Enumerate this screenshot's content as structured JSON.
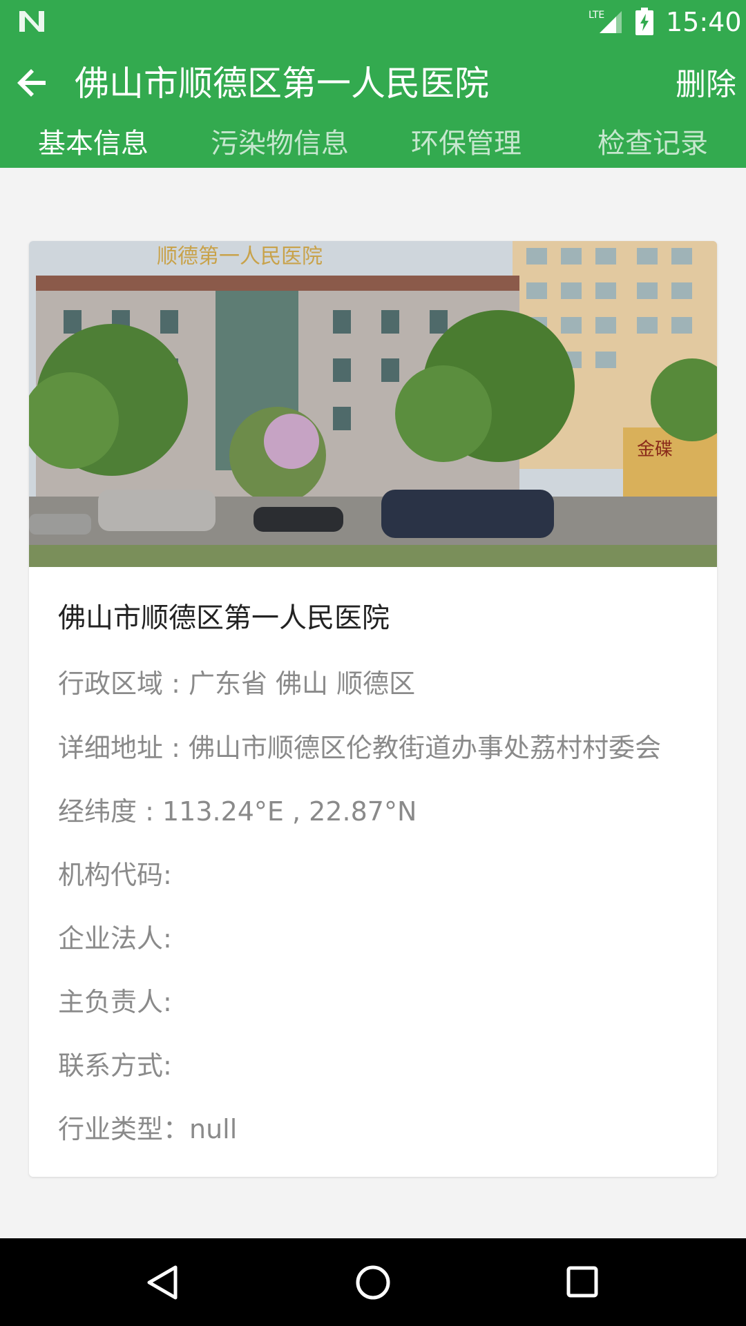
{
  "status_bar": {
    "time": "15:40",
    "network_label": "LTE",
    "notification_icon": "n-logo-icon",
    "signal_icon": "signal-icon",
    "battery_icon": "battery-charging-icon"
  },
  "app_bar": {
    "title": "佛山市顺德区第一人民医院",
    "back_icon": "arrow-back-icon",
    "delete_label": "删除",
    "color": "#33aa4f"
  },
  "tabs": [
    {
      "label": "基本信息",
      "active": true
    },
    {
      "label": "污染物信息",
      "active": false
    },
    {
      "label": "环保管理",
      "active": false
    },
    {
      "label": "检查记录",
      "active": false
    }
  ],
  "card": {
    "photo_sign": "顺德第一人民医院",
    "photo_side_sign": "金碟",
    "title": "佛山市顺德区第一人民医院",
    "rows": [
      {
        "text": "行政区域 : 广东省 佛山 顺德区"
      },
      {
        "text": "详细地址 : 佛山市顺德区伦教街道办事处荔村村委会"
      },
      {
        "text": "经纬度 : 113.24°E , 22.87°N"
      },
      {
        "text": "机构代码:"
      },
      {
        "text": "企业法人:"
      },
      {
        "text": "主负责人:"
      },
      {
        "text": "联系方式:"
      },
      {
        "text": "行业类型：null"
      }
    ]
  },
  "nav_bar": {
    "back_icon": "nav-back-icon",
    "home_icon": "nav-home-icon",
    "recents_icon": "nav-recents-icon"
  }
}
